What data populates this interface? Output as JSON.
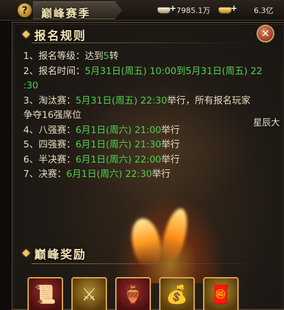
{
  "topbar": {
    "help_label": "?",
    "title": "巅峰赛季",
    "silver_value": "7985.1万",
    "gold_value": "6.3亿"
  },
  "panel": {
    "section_title": "报名规则",
    "close_label": "✕",
    "rules": [
      {
        "prefix": "1、报名等级：达到",
        "green": "5",
        "suffix": "转"
      },
      {
        "prefix": "2、报名时间：",
        "green": "5月31日(周五) 10:00到5月31日(周五) 22",
        "suffix": ""
      },
      {
        "prefix": "",
        "green": ":30",
        "suffix": ""
      },
      {
        "prefix": "3、淘汰赛：",
        "green": "5月31日(周五) 22:30",
        "suffix": "举行，所有报名玩家"
      },
      {
        "prefix": "争夺16强席位",
        "green": "",
        "suffix": ""
      },
      {
        "prefix": "4、八强赛：",
        "green": "6月1日(周六) 21:00",
        "suffix": "举行"
      },
      {
        "prefix": "5、四强赛：",
        "green": "6月1日(周六) 21:30",
        "suffix": "举行"
      },
      {
        "prefix": "6、半决赛：",
        "green": "6月1日(周六) 22:00",
        "suffix": "举行"
      },
      {
        "prefix": "7、决赛：",
        "green": "6月1日(周六) 22:30",
        "suffix": "举行"
      }
    ],
    "side_text": "星辰大",
    "rewards_title": "巅峰奖励"
  },
  "rewards": [
    {
      "icon": "scroll-icon",
      "frame": "red"
    },
    {
      "icon": "warrior-icon",
      "frame": "gold"
    },
    {
      "icon": "treasure-chest-icon",
      "frame": "red"
    },
    {
      "icon": "money-bag-icon",
      "frame": "gold"
    },
    {
      "icon": "talisman-icon",
      "frame": "gold"
    }
  ]
}
